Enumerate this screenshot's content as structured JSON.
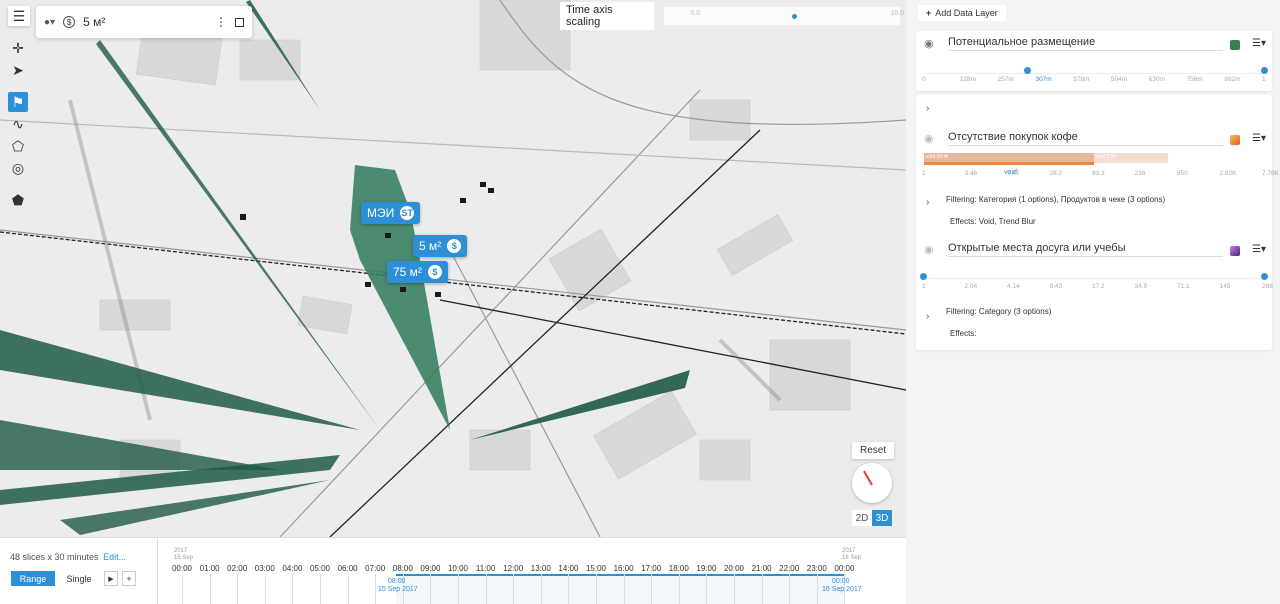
{
  "map": {
    "colors": {
      "bg": "#ececec",
      "road": "#999999",
      "rail": "#222222",
      "building": "#d6d6d6",
      "polygon": "#2f7a5a",
      "accent": "#2d8fd6"
    }
  },
  "toolbar": {
    "menu_icon": "hamburger-icon",
    "tools": [
      "move-icon",
      "pointer-icon",
      "flag-icon",
      "route-icon",
      "polygon-icon",
      "compass-icon",
      "pentagon-icon"
    ]
  },
  "topbox": {
    "value": "5 м²",
    "currency": "$"
  },
  "timescale": {
    "label": "Time axis scaling",
    "left_tick": "0.0",
    "right_tick": "10.0",
    "value_fraction": 0.53
  },
  "pins": [
    {
      "label": "МЭИ",
      "badge": "ST"
    },
    {
      "label": "5 м²",
      "badge": "$"
    },
    {
      "label": "75 м²",
      "badge": "$"
    }
  ],
  "controls": {
    "reset": "Reset",
    "mode_2d": "2D",
    "mode_3d": "3D",
    "selected_mode": "3D"
  },
  "timeline": {
    "slices_text": "48 slices x 30 minutes",
    "edit": "Edit...",
    "range_btn": "Range",
    "single_btn": "Single",
    "play": "▶",
    "add": "+",
    "start_year": "2017",
    "start_date": "15 Sep",
    "end_year": "2017",
    "end_date": "16 Sep",
    "hours": [
      "00:00",
      "01:00",
      "02:00",
      "03:00",
      "04:00",
      "05:00",
      "06:00",
      "07:00",
      "08:00",
      "09:00",
      "10:00",
      "11:00",
      "12:00",
      "13:00",
      "14:00",
      "15:00",
      "16:00",
      "17:00",
      "18:00",
      "19:00",
      "20:00",
      "21:00",
      "22:00",
      "23:00",
      "00:00"
    ],
    "sel_start_time": "08:00",
    "sel_start_date": "15 Sep 2017",
    "sel_end_time": "00:00",
    "sel_end_date": "16 Sep 2017"
  },
  "panel": {
    "add_layer": "Add Data Layer",
    "layers": [
      {
        "name": "Потенциальное размещение",
        "ticks": [
          "0",
          "128m",
          "257m",
          "307m",
          "378m",
          "504m",
          "630m",
          "756m",
          "882m",
          "1"
        ],
        "value": "307m",
        "swatch": "#3a7d4f"
      },
      {
        "name": "Отсутствие покупок кофе",
        "ticks": [
          "1",
          "3.46",
          "9.47",
          "28.2",
          "83.3",
          "236",
          "850",
          "2.82K",
          "7.76K"
        ],
        "bar_left": "void 10.4k",
        "bar_right": "void 0.3k",
        "void_label": "void",
        "filter_label": "Filtering:",
        "filter_value": "Категория",
        "filter_mid": "(1 options), ",
        "filter_value2": "Продуктов в чеке",
        "filter_end": "(3 options)",
        "effects_label": "Effects:",
        "effects_value": "Void, Trend Blur",
        "swatch": "#e0602a"
      },
      {
        "name": "Открытые места досуга или учебы",
        "ticks": [
          "1",
          "2.04",
          "4.14",
          "8.43",
          "17.2",
          "34.9",
          "71.1",
          "145",
          "288"
        ],
        "filter_label": "Filtering:",
        "filter_value": "Category",
        "filter_end": "(3 options)",
        "effects_label": "Effects:",
        "swatch": "#7a4a8f"
      }
    ]
  }
}
